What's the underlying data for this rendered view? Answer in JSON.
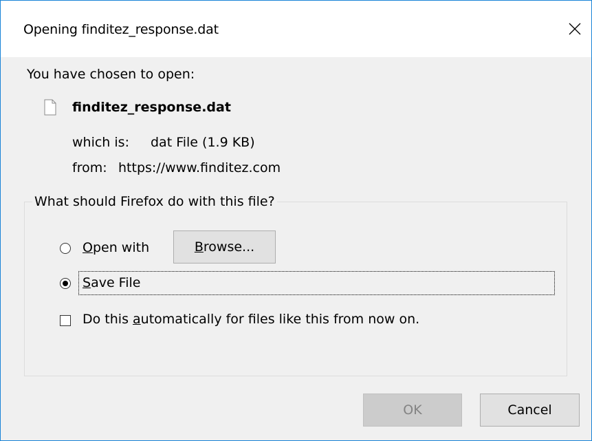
{
  "window": {
    "title": "Opening finditez_response.dat",
    "accent_color": "#1883d7"
  },
  "icons": {
    "close": "close-icon",
    "file": "file-icon"
  },
  "content": {
    "intro": "You have chosen to open:",
    "filename": "finditez_response.dat",
    "which_is_label": "which is:",
    "which_is_value": "dat File (1.9 KB)",
    "from_label": "from:",
    "from_value": "https://www.finditez.com"
  },
  "action_group": {
    "legend": "What should Firefox do with this file?",
    "open_with": {
      "mnemonic": "O",
      "rest": "pen with",
      "checked": false
    },
    "browse": {
      "mnemonic": "B",
      "rest": "rowse..."
    },
    "save_file": {
      "mnemonic": "S",
      "rest": "ave File",
      "checked": true
    },
    "auto": {
      "before": "Do this ",
      "mnemonic": "a",
      "after": "utomatically for files like this from now on.",
      "checked": false
    }
  },
  "buttons": {
    "ok": {
      "label": "OK",
      "enabled": false
    },
    "cancel": {
      "label": "Cancel",
      "enabled": true
    }
  }
}
